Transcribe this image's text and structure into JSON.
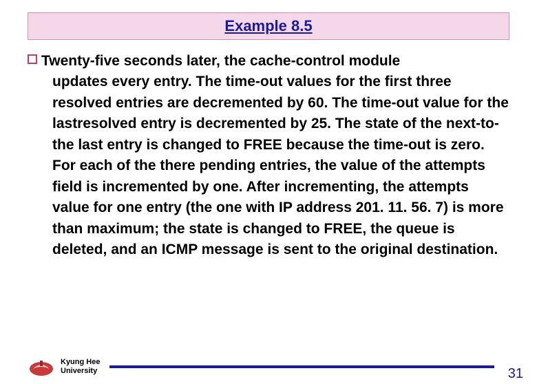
{
  "title": "Example 8.5",
  "bullet": {
    "first_line": "Twenty-five seconds later, the cache-control module",
    "rest": "updates every entry. The time-out values for the first three resolved entries are decremented by 60. The time-out value for the lastresolved entry is decremented by 25. The state of the next-to-the last entry is changed to FREE because the time-out is zero. For each of the there pending entries, the value of the attempts field is incremented by one. After incrementing, the attempts value for one entry (the one with IP address 201. 11. 56. 7) is more than maximum; the state is changed to FREE, the queue is deleted, and an ICMP message is sent to the original destination."
  },
  "footer": {
    "university_line1": "Kyung Hee",
    "university_line2": "University",
    "page_number": "31"
  }
}
